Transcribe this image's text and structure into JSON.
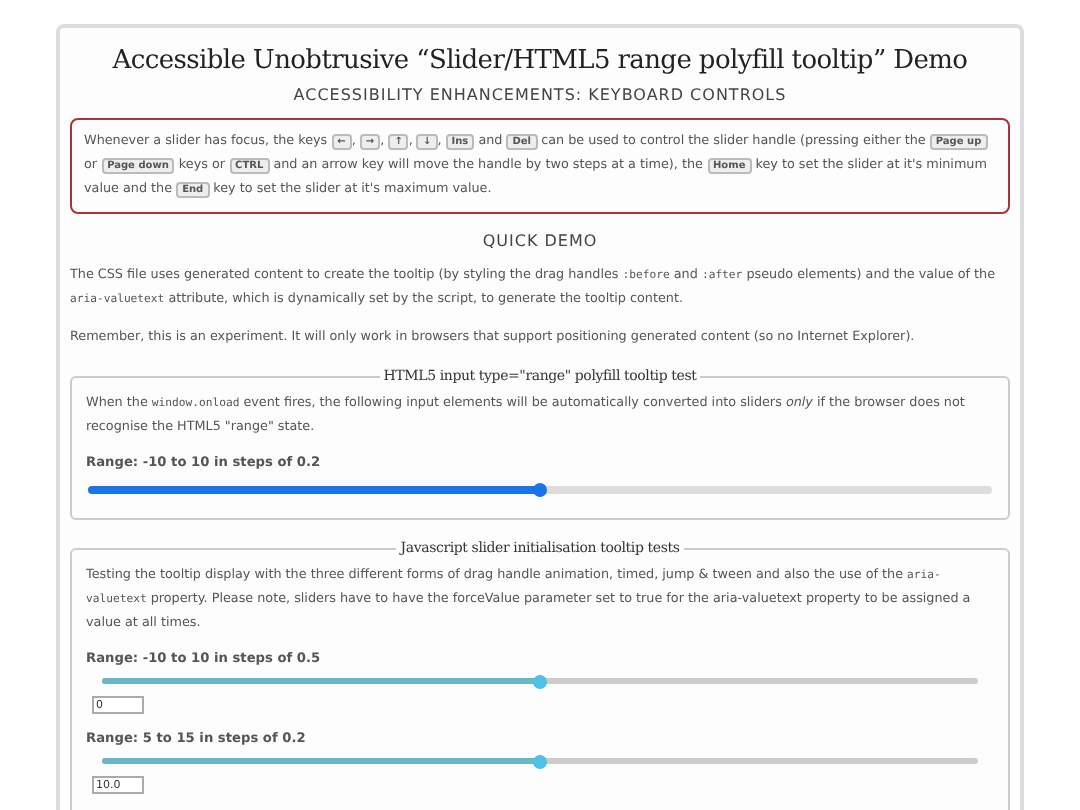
{
  "title": "Accessible Unobtrusive “Slider/HTML5 range polyfill tooltip” Demo",
  "keyboard_section": {
    "heading": "ACCESSIBILITY ENHANCEMENTS: KEYBOARD CONTROLS",
    "paragraph": [
      {
        "kind": "text",
        "text": "Whenever a slider has focus, the keys "
      },
      {
        "kind": "key",
        "text": "←"
      },
      {
        "kind": "text",
        "text": ", "
      },
      {
        "kind": "key",
        "text": "→"
      },
      {
        "kind": "text",
        "text": ", "
      },
      {
        "kind": "key",
        "text": "↑"
      },
      {
        "kind": "text",
        "text": ", "
      },
      {
        "kind": "key",
        "text": "↓"
      },
      {
        "kind": "text",
        "text": ", "
      },
      {
        "kind": "key",
        "text": "Ins"
      },
      {
        "kind": "text",
        "text": " and "
      },
      {
        "kind": "key",
        "text": "Del"
      },
      {
        "kind": "text",
        "text": " can be used to control the slider handle (pressing either the "
      },
      {
        "kind": "key",
        "text": "Page up"
      },
      {
        "kind": "text",
        "text": " or "
      },
      {
        "kind": "key",
        "text": "Page down"
      },
      {
        "kind": "text",
        "text": " keys or "
      },
      {
        "kind": "key",
        "text": "CTRL"
      },
      {
        "kind": "text",
        "text": " and an arrow key will move the handle by two steps at a time), the "
      },
      {
        "kind": "key",
        "text": "Home"
      },
      {
        "kind": "text",
        "text": " key to set the slider at it's minimum value and the "
      },
      {
        "kind": "key",
        "text": "End"
      },
      {
        "kind": "text",
        "text": " key to set the slider at it's maximum value."
      }
    ]
  },
  "quick_demo": {
    "heading": "QUICK DEMO",
    "paragraphs": [
      [
        {
          "kind": "text",
          "text": "The CSS file uses generated content to create the tooltip (by styling the drag handles "
        },
        {
          "kind": "code",
          "text": ":before"
        },
        {
          "kind": "text",
          "text": " and "
        },
        {
          "kind": "code",
          "text": ":after"
        },
        {
          "kind": "text",
          "text": " pseudo elements) and the value of the "
        },
        {
          "kind": "code",
          "text": "aria-valuetext"
        },
        {
          "kind": "text",
          "text": " attribute, which is dynamically set by the script, to generate the tooltip content."
        }
      ],
      [
        {
          "kind": "text",
          "text": "Remember, this is an experiment. It will only work in browsers that support positioning generated content (so no Internet Explorer)."
        }
      ]
    ]
  },
  "fieldsets": [
    {
      "legend": "HTML5 input type=\"range\" polyfill tooltip test",
      "paragraph": [
        {
          "kind": "text",
          "text": "When the "
        },
        {
          "kind": "code",
          "text": "window.onload"
        },
        {
          "kind": "text",
          "text": " event fires, the following input elements will be automatically converted into sliders *only* if the browser does not recognise the HTML5 \"range\" state."
        }
      ],
      "sliders": [
        {
          "label": "Range: -10 to 10 in steps of 0.2",
          "kind": "native",
          "level": 0.5
        }
      ]
    },
    {
      "legend": "Javascript slider initialisation tooltip tests",
      "paragraph": [
        {
          "kind": "text",
          "text": "Testing the tooltip display with the three different forms of drag handle animation, timed, jump & tween and also the use of the "
        },
        {
          "kind": "code",
          "text": "aria-valuetext"
        },
        {
          "kind": "text",
          "text": " property. Please note, sliders have to have the forceValue parameter set to true for the aria-valuetext property to be assigned a value at all times."
        }
      ],
      "sliders": [
        {
          "label": "Range: -10 to 10 in steps of 0.5",
          "kind": "scripted",
          "level": 0.5,
          "value": "0"
        },
        {
          "label": "Range: 5 to 15 in steps of 0.2",
          "kind": "scripted",
          "level": 0.5,
          "value": "10.0"
        }
      ]
    }
  ]
}
